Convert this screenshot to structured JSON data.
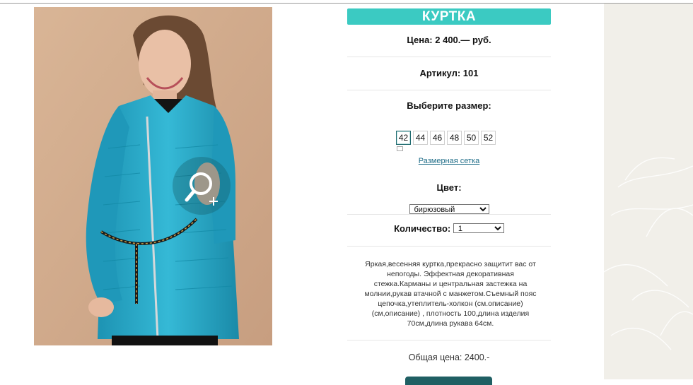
{
  "product": {
    "title": "КУРТКА",
    "price": "Цена: 2 400.— руб.",
    "article": "Артикул: 101",
    "size_prompt": "Выберите размер:",
    "sizes": [
      "42",
      "44",
      "46",
      "48",
      "50",
      "52"
    ],
    "size_chart_link": "Размерная сетка",
    "color_label": "Цвет:",
    "color_value": "бирюзовый",
    "quantity_label": "Количество:",
    "quantity_value": "1",
    "description": "Яркая,весенняя куртка,прекрасно защитит вас от непогоды. Эффектная декоративная стежка.Карманы и центральная застежка на молнии,рукав втачной с манжетом.Съемный пояс цепочка,утеплитель-холкон (см.описание) (см,описание) , плотность 100,длина изделия 70см,длина рукава 64см.",
    "total": "Общая цена: 2400.-"
  },
  "colors": {
    "accent": "#3bcac2",
    "jacket": "#2aa7c4",
    "button": "#1f5f63"
  },
  "icons": {
    "zoom": "magnifier-plus-icon"
  }
}
